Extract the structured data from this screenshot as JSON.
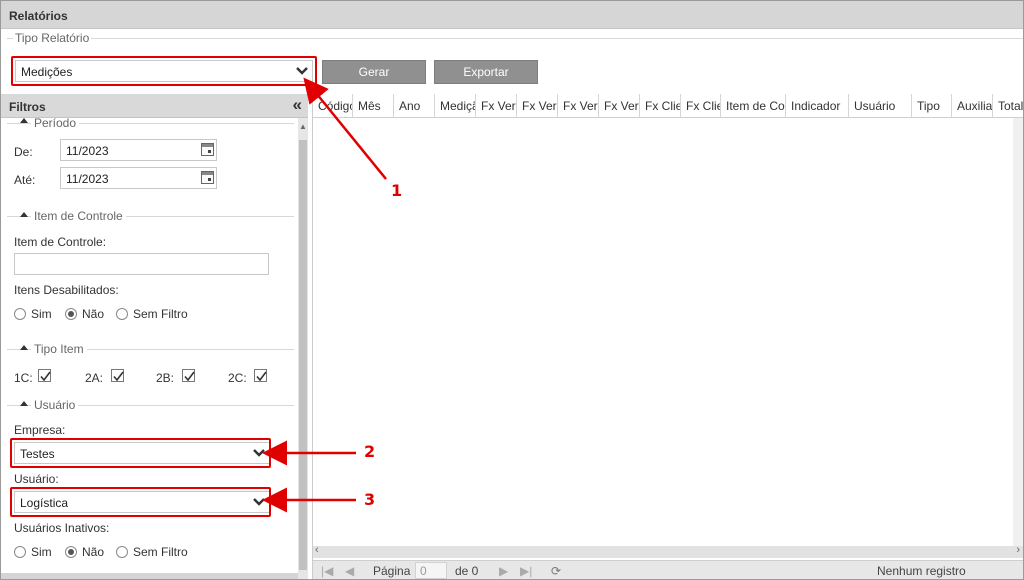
{
  "window": {
    "title": "Relatórios"
  },
  "tipo_relatorio": {
    "legend": "Tipo Relatório",
    "selected": "Medições",
    "gerar_label": "Gerar",
    "exportar_label": "Exportar"
  },
  "filtros": {
    "title": "Filtros",
    "collapse_glyph": "«",
    "periodo": {
      "legend": "Período",
      "de_label": "De:",
      "de_value": "11/2023",
      "ate_label": "Até:",
      "ate_value": "11/2023"
    },
    "item_controle": {
      "legend": "Item de Controle",
      "field_label": "Item de Controle:",
      "field_value": "",
      "desabilitados_label": "Itens Desabilitados:",
      "options": [
        "Sim",
        "Não",
        "Sem Filtro"
      ],
      "selected": "Não"
    },
    "tipo_item": {
      "legend": "Tipo Item",
      "items": [
        {
          "label": "1C:",
          "checked": true
        },
        {
          "label": "2A:",
          "checked": true
        },
        {
          "label": "2B:",
          "checked": true
        },
        {
          "label": "2C:",
          "checked": true
        }
      ]
    },
    "usuario": {
      "legend": "Usuário",
      "empresa_label": "Empresa:",
      "empresa_value": "Testes",
      "usuario_label": "Usuário:",
      "usuario_value": "Logística",
      "inativos_label": "Usuários Inativos:",
      "options": [
        "Sim",
        "Não",
        "Sem Filtro"
      ],
      "selected": "Não"
    }
  },
  "grid": {
    "columns": [
      "Código",
      "Mês",
      "Ano",
      "Medição",
      "Fx Verde",
      "Fx Verde",
      "Fx Verm",
      "Fx Verm",
      "Fx Clien",
      "Fx Clien",
      "Item de Con",
      "Indicador",
      "Usuário",
      "Tipo",
      "Auxiliar",
      "Totalizador"
    ],
    "pager": {
      "page_label": "Página",
      "page_value": "0",
      "of_label": "de 0",
      "status": "Nenhum registro encontrado"
    }
  },
  "annotations": [
    "1",
    "2",
    "3"
  ],
  "colors": {
    "annotation": "#e00000",
    "button": "#909090",
    "header": "#d6d6d6"
  }
}
